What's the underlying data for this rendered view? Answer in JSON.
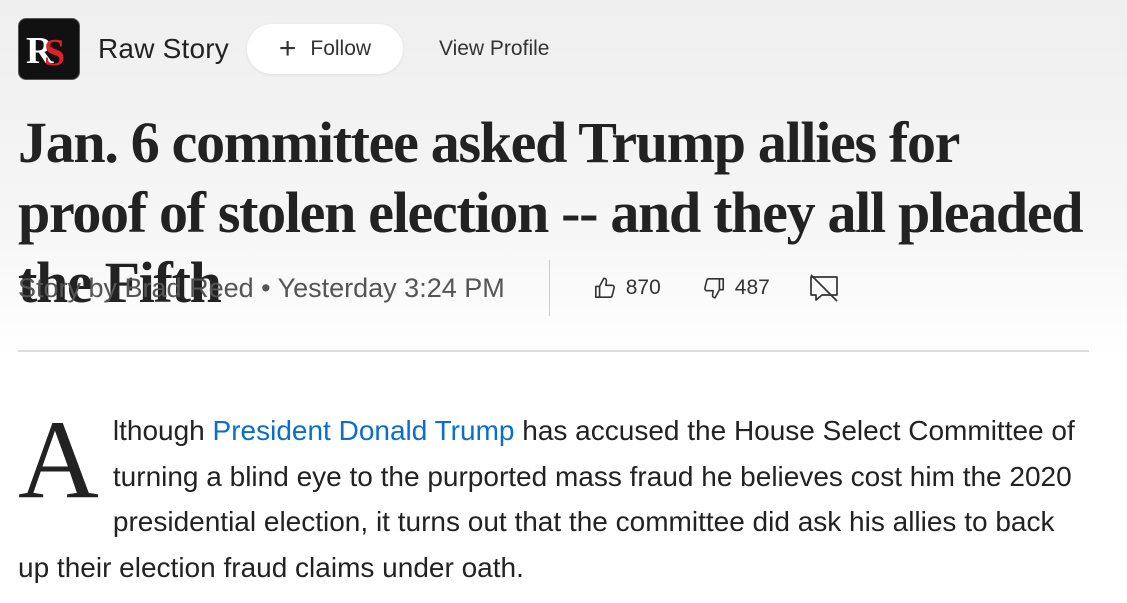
{
  "header": {
    "logo_text": "RS",
    "publisher": "Raw Story",
    "follow_label": "Follow",
    "follow_icon": "plus-icon",
    "view_profile_label": "View Profile"
  },
  "article": {
    "headline": "Jan. 6 committee asked Trump allies for proof of stolen election -- and they all pleaded the Fifth",
    "byline": "Story by Brad Reed • Yesterday 3:24 PM",
    "likes": "870",
    "dislikes": "487",
    "body": {
      "dropcap": "A",
      "intro": "lthough ",
      "link_text": "President Donald Trump",
      "rest": " has accused the House Select Committee of turning a blind eye to the purported mass fraud he believes cost him the 2020 presidential election, it turns out that the committee did ask his allies to back up their election fraud claims under oath."
    }
  },
  "icons": {
    "like": "thumbs-up-icon",
    "dislike": "thumbs-down-icon",
    "comments": "comments-off-icon"
  },
  "colors": {
    "link": "#0a6ecc",
    "logo_red": "#e0202a"
  }
}
